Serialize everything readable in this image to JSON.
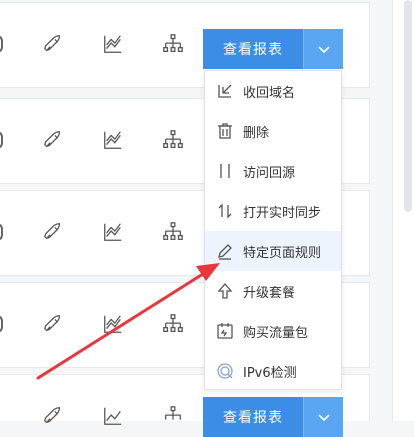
{
  "rows": [
    {
      "report_label": "查看报表"
    },
    {
      "report_label": ""
    },
    {
      "report_label": ""
    },
    {
      "report_label": ""
    },
    {
      "report_label": "查看报表"
    }
  ],
  "row_icons": [
    "rocket-icon",
    "trend-chart-icon",
    "hierarchy-icon"
  ],
  "dropdown": {
    "items": [
      {
        "label": "收回域名",
        "icon": "reclaim-icon"
      },
      {
        "label": "删除",
        "icon": "trash-icon"
      },
      {
        "label": "访问回源",
        "icon": "origin-icon"
      },
      {
        "label": "打开实时同步",
        "icon": "sync-icon"
      },
      {
        "label": "特定页面规则",
        "icon": "pencil-icon",
        "active": true
      },
      {
        "label": "升级套餐",
        "icon": "upgrade-arrow-icon"
      },
      {
        "label": "购买流量包",
        "icon": "traffic-pack-icon"
      },
      {
        "label": "IPv6检测",
        "icon": "ipv6-check-icon"
      }
    ]
  },
  "colors": {
    "button_primary": "#3b8de6",
    "button_secondary": "#5aa6f2",
    "annotation_arrow": "#e8363c",
    "active_item_bg": "#eef4fe"
  }
}
